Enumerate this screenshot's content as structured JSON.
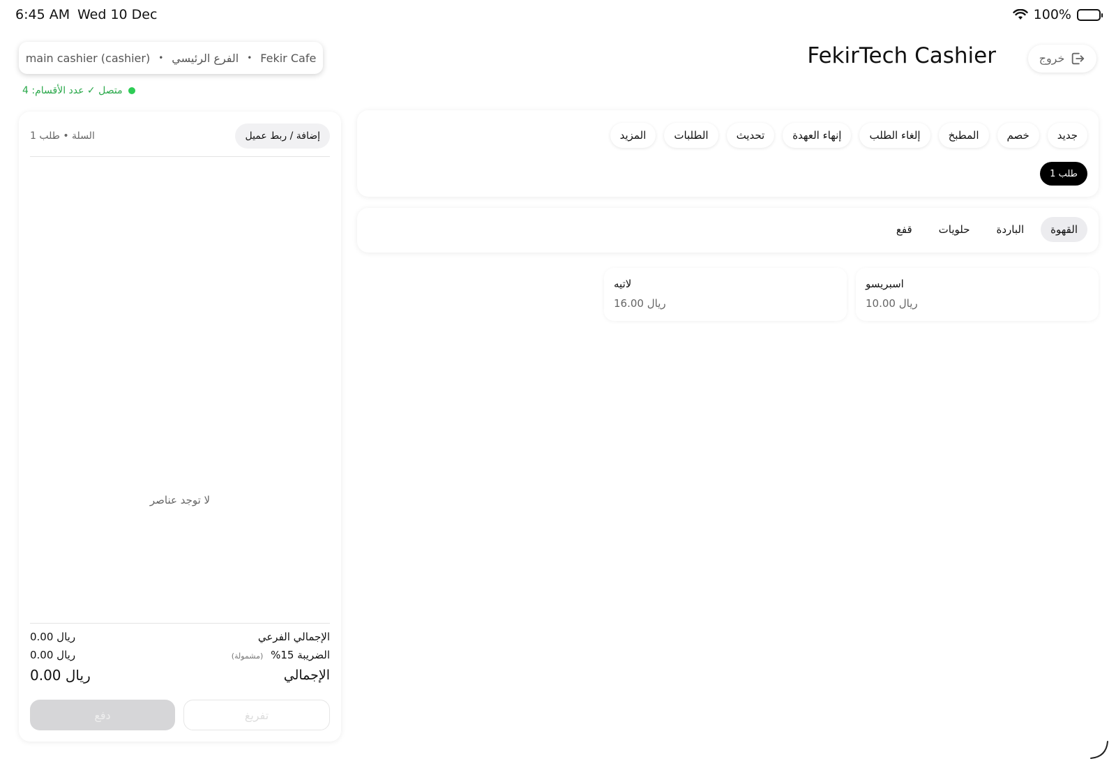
{
  "status_bar": {
    "time": "6:45 AM",
    "date": "Wed 10 Dec",
    "battery": "100%"
  },
  "session": {
    "cashier": "main cashier (cashier)",
    "branch": "الفرع الرئيسي",
    "cafe": "Fekir Cafe",
    "separator": "•"
  },
  "connection": {
    "text": "متصل ✓ عدد الأقسام: 4",
    "color": "#2aa84a"
  },
  "header": {
    "title": "FekirTech Cashier",
    "logout_label": "خروج"
  },
  "cart": {
    "label": "السلة • طلب 1",
    "customer_button": "إضافة / ربط عميل",
    "empty_text": "لا توجد عناصر",
    "subtotal_label": "الإجمالي الفرعي",
    "subtotal_value": "0.00 ريال",
    "tax_label": "الضريبة 15%",
    "tax_note": "(مشمولة)",
    "tax_value": "0.00 ريال",
    "total_label": "الإجمالي",
    "total_value": "0.00 ريال",
    "pay_button": "دفع",
    "clear_button": "تفريغ"
  },
  "toolbar": {
    "actions": [
      "جديد",
      "خصم",
      "المطبخ",
      "إلغاء الطلب",
      "إنهاء العهدة",
      "تحديث",
      "الطلبات",
      "المزيد"
    ],
    "order_tab": "طلب 1"
  },
  "categories": {
    "items": [
      "القهوة",
      "الباردة",
      "حلويات",
      "قفع"
    ],
    "active": "القهوة"
  },
  "products": [
    {
      "name": "اسبريسو",
      "price": "10.00 ريال"
    },
    {
      "name": "لاتيه",
      "price": "16.00 ريال"
    }
  ]
}
